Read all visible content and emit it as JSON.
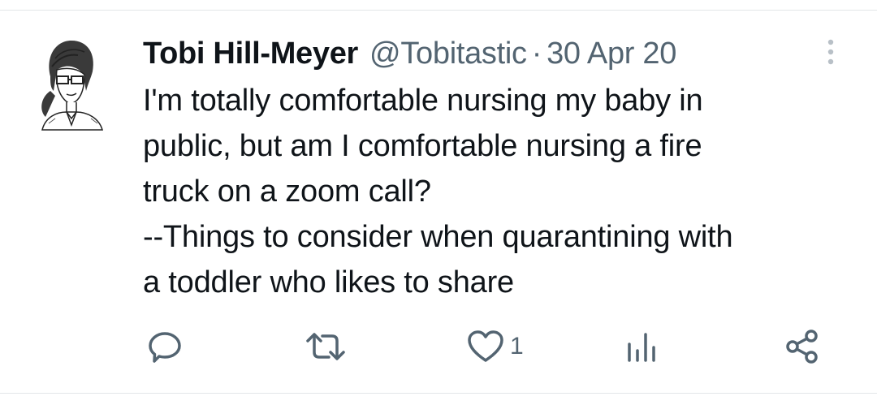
{
  "tweet": {
    "author": {
      "display_name": "Tobi Hill-Meyer",
      "handle": "@Tobitastic"
    },
    "separator": "·",
    "date": "30 Apr 20",
    "body_lines": [
      "I'm totally comfortable nursing my baby in",
      "public, but am I comfortable nursing a fire",
      "truck on a zoom call?",
      "--Things to consider when quarantining with",
      "a toddler who likes to share"
    ]
  },
  "actions": {
    "reply": {
      "icon": "reply-icon"
    },
    "retweet": {
      "icon": "retweet-icon"
    },
    "like": {
      "icon": "heart-icon",
      "count": "1"
    },
    "views": {
      "icon": "bar-chart-icon"
    },
    "share": {
      "icon": "share-icon"
    }
  },
  "menu": {
    "icon": "more-vertical-icon"
  },
  "colors": {
    "text_primary": "#0f1419",
    "text_secondary": "#536471",
    "divider": "#e3e6e8"
  }
}
